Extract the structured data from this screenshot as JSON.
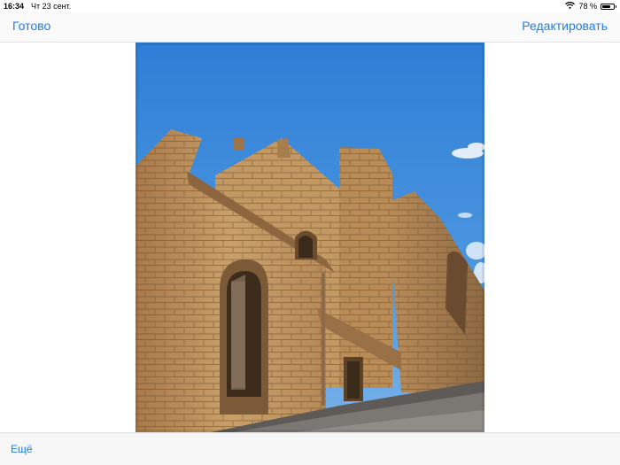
{
  "status_bar": {
    "time": "16:34",
    "date": "Чт 23 сент.",
    "battery_text": "78 %",
    "battery_level": 0.78,
    "icons": [
      "wifi-icon",
      "battery-icon"
    ]
  },
  "nav_bar": {
    "done_label": "Готово",
    "edit_label": "Редактировать"
  },
  "photo": {
    "subject": "stone-church-building"
  },
  "toolbar": {
    "more_label": "Ещё"
  },
  "colors": {
    "accent": "#1e7cf2",
    "sky": "#3b8ad8",
    "stone": "#c9a06a"
  }
}
